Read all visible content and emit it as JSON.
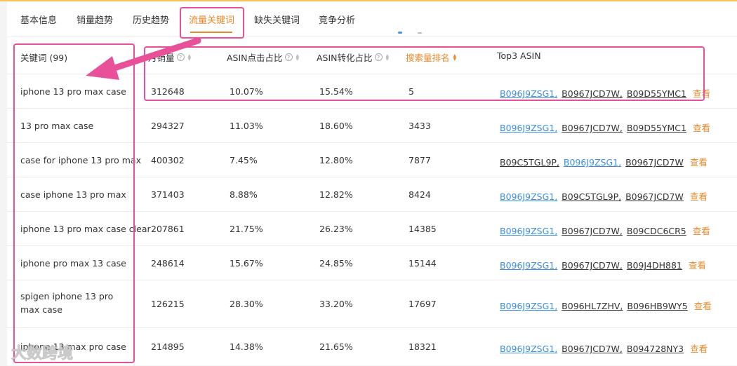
{
  "tabs": [
    {
      "label": "基本信息"
    },
    {
      "label": "销量趋势"
    },
    {
      "label": "历史趋势"
    },
    {
      "label": "流量关键词"
    },
    {
      "label": "缺失关键词"
    },
    {
      "label": "竞争分析"
    }
  ],
  "active_tab": "流量关键词",
  "table": {
    "headers": {
      "keyword": "关键词 (99)",
      "monthly_sales": "月销量",
      "asin_click_share": "ASIN点击占比",
      "asin_conversion_share": "ASIN转化占比",
      "search_rank": "搜索量排名",
      "top3_asin": "Top3 ASIN"
    },
    "view_label": "查看",
    "rows": [
      {
        "keyword": "iphone 13 pro max case",
        "sales": "312648",
        "click": "10.07%",
        "conv": "15.54%",
        "rank": "5",
        "asins": [
          {
            "id": "B096J9ZSG1,",
            "hl": true
          },
          {
            "id": "B0967JCD7W,",
            "hl": false
          },
          {
            "id": "B09D55YMC1",
            "hl": false
          }
        ]
      },
      {
        "keyword": "13 pro max case",
        "sales": "294327",
        "click": "11.03%",
        "conv": "18.60%",
        "rank": "3433",
        "asins": [
          {
            "id": "B096J9ZSG1,",
            "hl": true
          },
          {
            "id": "B0967JCD7W,",
            "hl": false
          },
          {
            "id": "B09D55YMC1",
            "hl": false
          }
        ]
      },
      {
        "keyword": "case for iphone 13 pro max",
        "sales": "400302",
        "click": "7.45%",
        "conv": "12.80%",
        "rank": "7877",
        "asins": [
          {
            "id": "B09C5TGL9P,",
            "hl": false
          },
          {
            "id": "B096J9ZSG1,",
            "hl": true
          },
          {
            "id": "B0967JCD7W",
            "hl": false
          }
        ]
      },
      {
        "keyword": "case iphone 13 pro max",
        "sales": "371403",
        "click": "8.88%",
        "conv": "12.82%",
        "rank": "8424",
        "asins": [
          {
            "id": "B096J9ZSG1,",
            "hl": true
          },
          {
            "id": "B09C5TGL9P,",
            "hl": false
          },
          {
            "id": "B0967JCD7W",
            "hl": false
          }
        ]
      },
      {
        "keyword": "iphone 13 pro max case clear",
        "sales": "207861",
        "click": "21.75%",
        "conv": "26.23%",
        "rank": "14385",
        "asins": [
          {
            "id": "B096J9ZSG1,",
            "hl": true
          },
          {
            "id": "B0967JCD7W,",
            "hl": false
          },
          {
            "id": "B09CDC6CR5",
            "hl": false
          }
        ]
      },
      {
        "keyword": "iphone pro max 13 case",
        "sales": "248614",
        "click": "15.67%",
        "conv": "24.85%",
        "rank": "15144",
        "asins": [
          {
            "id": "B096J9ZSG1,",
            "hl": true
          },
          {
            "id": "B0967JCD7W,",
            "hl": false
          },
          {
            "id": "B09J4DH881",
            "hl": false
          }
        ]
      },
      {
        "keyword": "spigen iphone 13 pro max case",
        "sales": "126215",
        "click": "28.30%",
        "conv": "33.20%",
        "rank": "17697",
        "asins": [
          {
            "id": "B096J9ZSG1,",
            "hl": true
          },
          {
            "id": "B096HL7ZHV,",
            "hl": false
          },
          {
            "id": "B096HB9WY5",
            "hl": false
          }
        ]
      },
      {
        "keyword": "iphone 13 max pro case",
        "sales": "214895",
        "click": "14.38%",
        "conv": "21.65%",
        "rank": "18321",
        "asins": [
          {
            "id": "B096J9ZSG1,",
            "hl": true
          },
          {
            "id": "B0967JCD7W,",
            "hl": false
          },
          {
            "id": "B094728NY3",
            "hl": false
          }
        ]
      }
    ]
  },
  "watermark": "大数跨境",
  "colors": {
    "accent": "#e8892a",
    "annotation": "#e8519a",
    "link_highlight": "#3a8ee6"
  }
}
